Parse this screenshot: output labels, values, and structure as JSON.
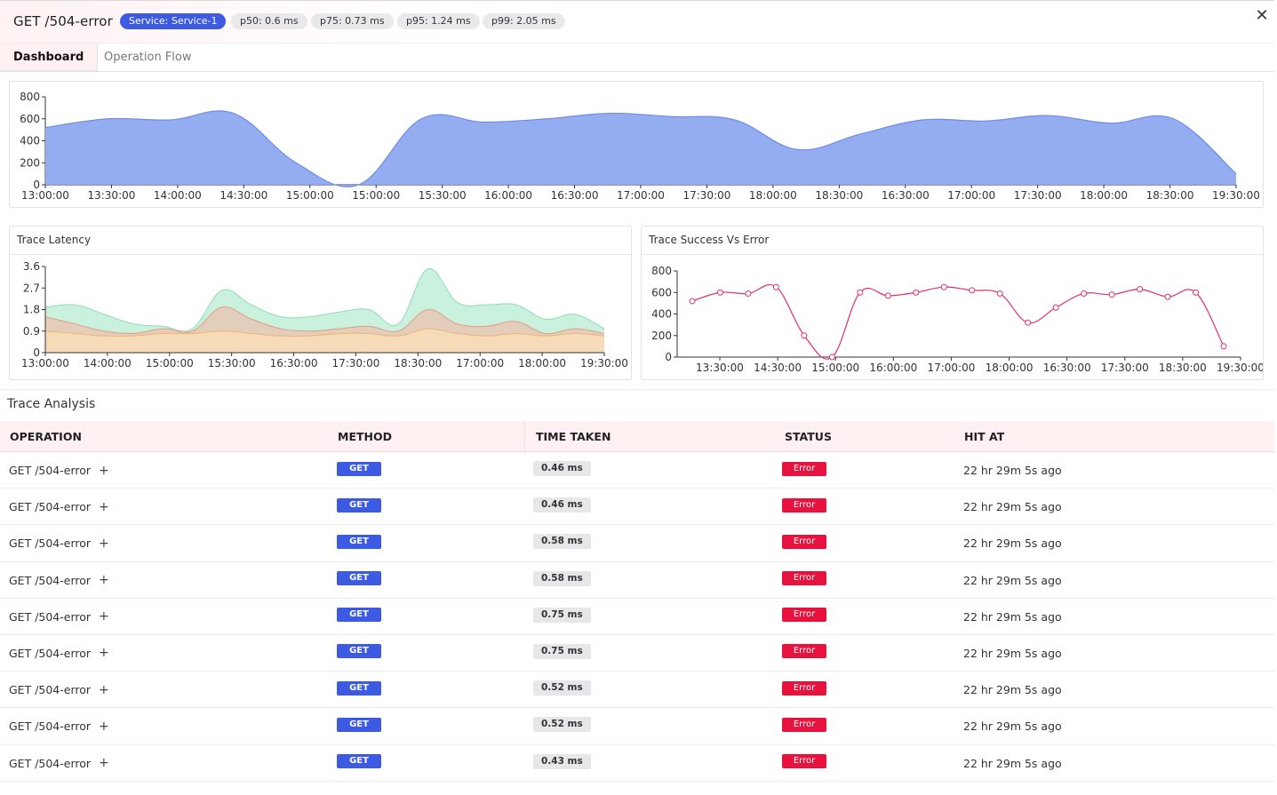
{
  "header": {
    "title": "GET /504-error",
    "pills": [
      {
        "label": "Service: Service-1",
        "kind": "service"
      },
      {
        "label": "p50: 0.6 ms",
        "kind": "plain"
      },
      {
        "label": "p75: 0.73 ms",
        "kind": "plain"
      },
      {
        "label": "p95: 1.24 ms",
        "kind": "plain"
      },
      {
        "label": "p99: 2.05 ms",
        "kind": "plain"
      }
    ],
    "close_glyph": "✕"
  },
  "tabs": [
    {
      "label": "Dashboard",
      "active": true
    },
    {
      "label": "Operation Flow",
      "active": false
    }
  ],
  "colors": {
    "accent_blue": "#3d5ae3",
    "error_red": "#e8123f",
    "area_blue": "#8ea9f0",
    "success_line": "#e0306a",
    "latency_green": "#9be3c0",
    "latency_orange": "#f3b07a",
    "header_pink": "#fff0f2"
  },
  "chart_data": [
    {
      "type": "area",
      "title": "",
      "x": [
        "13:00:00",
        "13:30:00",
        "14:00:00",
        "14:30:00",
        "15:00:00",
        "15:00:00",
        "15:30:00",
        "16:00:00",
        "16:30:00",
        "17:00:00",
        "17:30:00",
        "18:00:00",
        "18:30:00",
        "16:30:00",
        "17:00:00",
        "17:30:00",
        "18:00:00",
        "18:30:00",
        "19:30:00"
      ],
      "x_tick_labels": [
        "13:00:00",
        "13:30:00",
        "14:00:00",
        "14:30:00",
        "15:00:00",
        "15:00:00",
        "15:30:00",
        "16:00:00",
        "16:30:00",
        "17:00:00",
        "17:30:00",
        "18:00:00",
        "18:30:00",
        "16:30:00",
        "17:00:00",
        "17:30:00",
        "18:00:00",
        "18:30:00",
        "19:30:00"
      ],
      "series": [
        {
          "values": [
            520,
            600,
            590,
            650,
            200,
            0,
            600,
            570,
            600,
            650,
            620,
            590,
            320,
            460,
            590,
            580,
            630,
            560,
            600,
            100
          ]
        }
      ],
      "ylim": [
        0,
        800
      ],
      "yticks": [
        0,
        200,
        400,
        600,
        800
      ],
      "grid": false
    },
    {
      "type": "area",
      "title": "Trace Latency",
      "x_tick_labels": [
        "13:00:00",
        "14:00:00",
        "15:00:00",
        "15:30:00",
        "16:30:00",
        "17:30:00",
        "18:30:00",
        "17:00:00",
        "18:00:00",
        "19:30:00"
      ],
      "series": [
        {
          "values": [
            1.9,
            2.0,
            1.6,
            1.2,
            1.1,
            1.0,
            2.6,
            2.0,
            1.5,
            1.5,
            1.7,
            1.8,
            1.2,
            3.5,
            2.1,
            2.0,
            2.0,
            1.4,
            1.6,
            1.0
          ]
        },
        {
          "values": [
            1.5,
            1.2,
            0.9,
            0.8,
            1.0,
            0.9,
            1.9,
            1.4,
            1.0,
            0.9,
            1.0,
            1.1,
            0.9,
            1.8,
            1.2,
            1.1,
            1.3,
            0.8,
            1.0,
            0.8
          ]
        },
        {
          "values": [
            0.9,
            0.8,
            0.7,
            0.7,
            0.8,
            0.8,
            0.9,
            0.8,
            0.7,
            0.7,
            0.8,
            0.8,
            0.7,
            1.0,
            0.8,
            0.7,
            0.8,
            0.7,
            0.8,
            0.7
          ]
        }
      ],
      "ylim": [
        0,
        3.6
      ],
      "yticks": [
        0,
        0.9,
        1.8,
        2.7,
        3.6
      ],
      "grid": false
    },
    {
      "type": "line",
      "title": "Trace Success Vs Error",
      "x_tick_labels": [
        "13:30:00",
        "14:30:00",
        "15:00:00",
        "16:00:00",
        "17:00:00",
        "18:00:00",
        "16:30:00",
        "17:30:00",
        "18:30:00",
        "19:30:00"
      ],
      "series": [
        {
          "values": [
            520,
            600,
            590,
            650,
            200,
            0,
            600,
            570,
            600,
            650,
            620,
            590,
            320,
            460,
            590,
            580,
            630,
            560,
            600,
            100
          ]
        }
      ],
      "ylim": [
        0,
        800
      ],
      "yticks": [
        0,
        200,
        400,
        600,
        800
      ],
      "grid": false
    }
  ],
  "trace_analysis": {
    "title": "Trace Analysis",
    "columns": [
      "OPERATION",
      "METHOD",
      "TIME TAKEN",
      "STATUS",
      "HIT AT"
    ],
    "rows": [
      {
        "operation": "GET /504-error",
        "method": "GET",
        "time": "0.46 ms",
        "status": "Error",
        "hit_at": "22 hr 29m 5s ago"
      },
      {
        "operation": "GET /504-error",
        "method": "GET",
        "time": "0.46 ms",
        "status": "Error",
        "hit_at": "22 hr 29m 5s ago"
      },
      {
        "operation": "GET /504-error",
        "method": "GET",
        "time": "0.58 ms",
        "status": "Error",
        "hit_at": "22 hr 29m 5s ago"
      },
      {
        "operation": "GET /504-error",
        "method": "GET",
        "time": "0.58 ms",
        "status": "Error",
        "hit_at": "22 hr 29m 5s ago"
      },
      {
        "operation": "GET /504-error",
        "method": "GET",
        "time": "0.75 ms",
        "status": "Error",
        "hit_at": "22 hr 29m 5s ago"
      },
      {
        "operation": "GET /504-error",
        "method": "GET",
        "time": "0.75 ms",
        "status": "Error",
        "hit_at": "22 hr 29m 5s ago"
      },
      {
        "operation": "GET /504-error",
        "method": "GET",
        "time": "0.52 ms",
        "status": "Error",
        "hit_at": "22 hr 29m 5s ago"
      },
      {
        "operation": "GET /504-error",
        "method": "GET",
        "time": "0.52 ms",
        "status": "Error",
        "hit_at": "22 hr 29m 5s ago"
      },
      {
        "operation": "GET /504-error",
        "method": "GET",
        "time": "0.43 ms",
        "status": "Error",
        "hit_at": "22 hr 29m 5s ago"
      }
    ],
    "expand_glyph": "+"
  }
}
